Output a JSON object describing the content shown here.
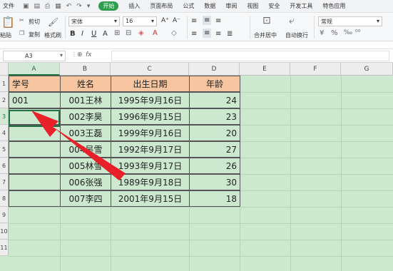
{
  "menu": {
    "file": "文件",
    "start": "开始",
    "tabs": [
      "插入",
      "页面布局",
      "公式",
      "数据",
      "审阅",
      "视图",
      "安全",
      "开发工具",
      "特色应用"
    ]
  },
  "ribbon": {
    "cut": "剪切",
    "copy": "复制",
    "paste": "粘贴",
    "format_painter": "格式刷",
    "font_name": "宋体",
    "font_size": "16",
    "merge_center": "合并居中",
    "wrap_text": "自动换行",
    "number_format": "常规"
  },
  "formula_bar": {
    "name_box": "A3",
    "fx": "fx",
    "formula": ""
  },
  "columns": [
    "A",
    "B",
    "C",
    "D",
    "E",
    "F",
    "G"
  ],
  "rows": [
    "1",
    "2",
    "3",
    "4",
    "5",
    "6",
    "7",
    "8",
    "9",
    "10",
    "11"
  ],
  "table": {
    "headers": [
      "学号",
      "姓名",
      "出生日期",
      "年龄"
    ],
    "rows": [
      [
        "001",
        "001王林",
        "1995年9月16日",
        "24"
      ],
      [
        "",
        "002李昊",
        "1996年9月15日",
        "23"
      ],
      [
        "",
        "003王磊",
        "1999年9月16日",
        "20"
      ],
      [
        "",
        "004吴雪",
        "1992年9月17日",
        "27"
      ],
      [
        "",
        "005林雪",
        "1993年9月17日",
        "26"
      ],
      [
        "",
        "006张强",
        "1989年9月18日",
        "30"
      ],
      [
        "",
        "007李四",
        "2001年9月15日",
        "18"
      ]
    ]
  },
  "colors": {
    "accent": "#217346",
    "header_fill": "#f7c6a1",
    "sheet_bg": "#cce8cf",
    "arrow": "#e8202a"
  }
}
